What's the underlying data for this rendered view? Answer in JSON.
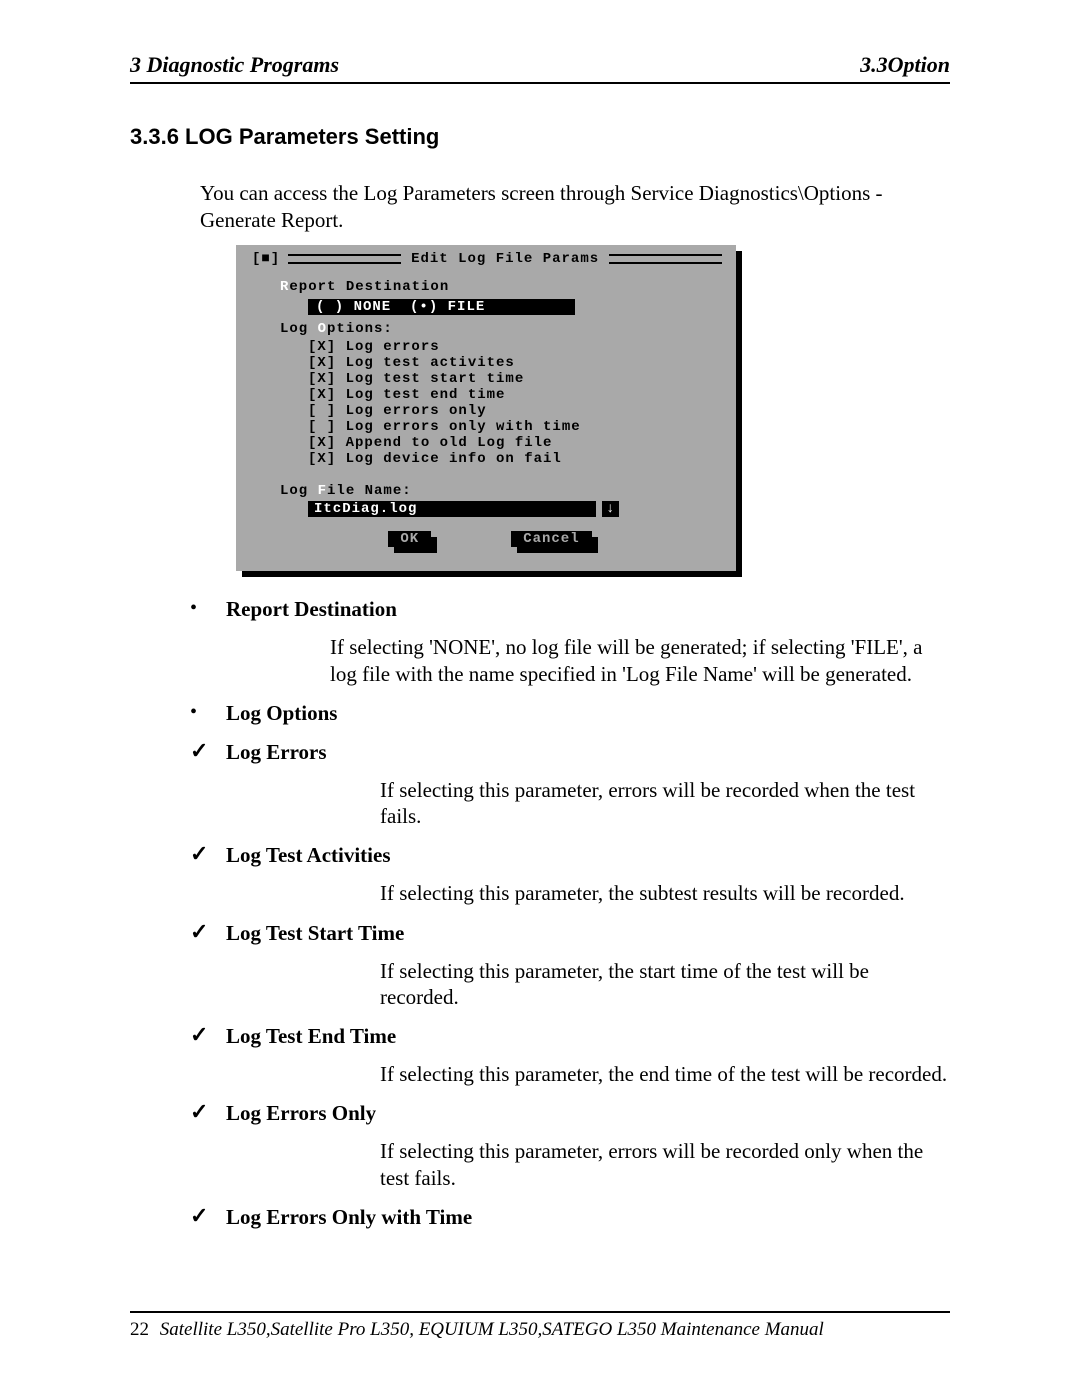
{
  "header": {
    "left": "3  Diagnostic Programs",
    "right": "3.3Option"
  },
  "heading": "3.3.6   LOG Parameters Setting",
  "intro": "You can access the Log Parameters screen through Service Diagnostics\\Options - Generate Report.",
  "dialog": {
    "title": "Edit Log File Params",
    "close_box": "[■]",
    "report_dest_label": "Report Destination",
    "report_dest_hot": "R",
    "radio_none": "( ) NONE",
    "radio_file": "(•) FILE",
    "log_options_label": "Log Options:",
    "log_options_hot": "O",
    "checks": [
      "[X] Log errors",
      "[X] Log test activites",
      "[X] Log test start time",
      "[X] Log test end time",
      "[ ] Log errors only",
      "[ ] Log errors only with time",
      "[X] Append to old Log file",
      "[X] Log device info on fail"
    ],
    "file_label": "Log File Name:",
    "file_hot": "F",
    "file_value": "ItcDiag.log",
    "arrow": "↓",
    "ok": "OK",
    "cancel": "Cancel"
  },
  "items": {
    "report_dest": {
      "title": "Report Destination",
      "desc": "If  selecting 'NONE', no log file will be generated; if selecting 'FILE', a log file with the name specified in 'Log File Name' will be generated."
    },
    "log_options_title": "Log Options",
    "log_errors": {
      "title": "Log Errors",
      "desc": "If selecting this parameter, errors will be recorded when the test fails."
    },
    "log_test_activities": {
      "title": "Log Test Activities",
      "desc": "If selecting this parameter, the subtest results will be recorded."
    },
    "log_test_start": {
      "title": "Log Test Start Time",
      "desc": "If selecting this parameter, the start time of the test will be recorded."
    },
    "log_test_end": {
      "title": "Log Test End Time",
      "desc": "If selecting this parameter, the end time of the test will be recorded."
    },
    "log_errors_only": {
      "title": "Log Errors Only",
      "desc": "If selecting this parameter, errors will be recorded only when the test fails."
    },
    "log_errors_only_time": {
      "title": "Log Errors Only with Time"
    }
  },
  "footer": {
    "page": "22",
    "text": "Satellite L350,Satellite Pro L350, EQUIUM L350,SATEGO L350 Maintenance Manual"
  }
}
